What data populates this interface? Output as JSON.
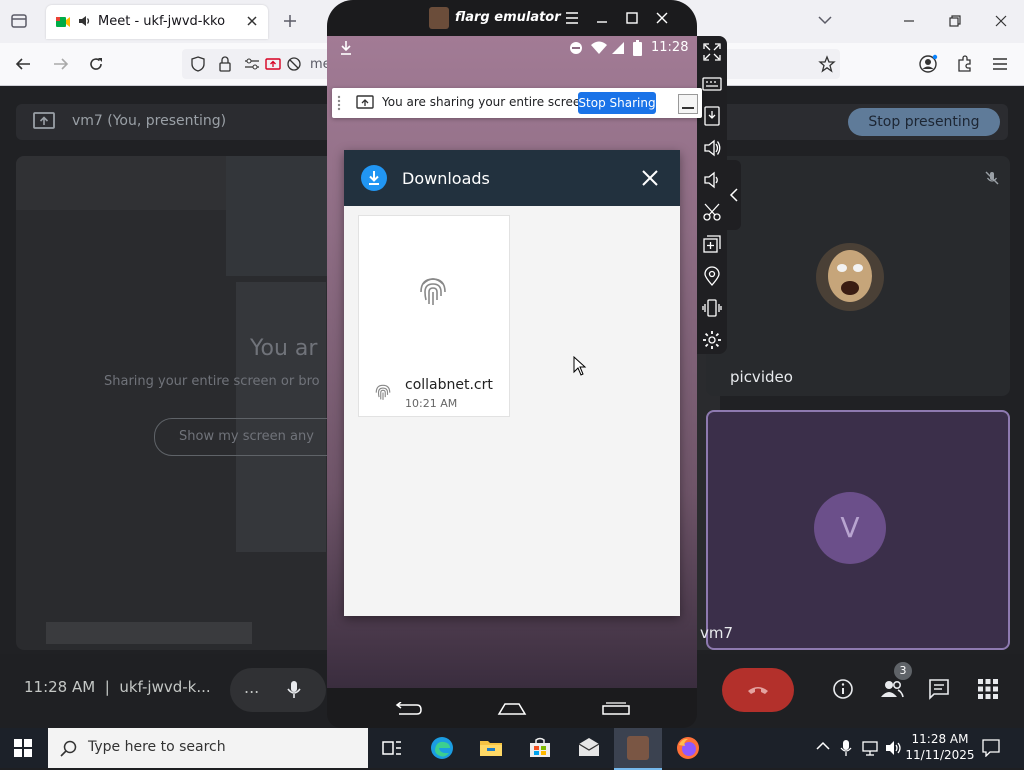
{
  "browser": {
    "tab_title": "Meet - ukf-jwvd-kko",
    "url_fragment": "me"
  },
  "meet": {
    "presenting_label": "vm7 (You, presenting)",
    "stop_presenting": "Stop presenting",
    "shared_text_big": "You ar",
    "shared_text_sub": "Sharing your entire screen or bro",
    "show_screen_btn": "Show my screen any",
    "participant_picvideo": "picvideo",
    "participant_vm7": "vm7",
    "avatar_letter": "V",
    "clock": "11:28 AM",
    "meeting_code": "ukf-jwvd-k...",
    "people_count": "3",
    "more_dots": "..."
  },
  "emulator": {
    "title": "flarg emulator",
    "status_time": "11:28",
    "share_notice": "You are sharing your entire screen.",
    "stop_sharing": "Stop Sharing",
    "downloads_title": "Downloads",
    "file": {
      "name": "collabnet.crt",
      "time": "10:21 AM"
    }
  },
  "taskbar": {
    "search_placeholder": "Type here to search",
    "time": "11:28 AM",
    "date": "11/11/2025"
  },
  "colors": {
    "accent_blue": "#1a73e8",
    "end_call_red": "#b3302b",
    "downloads_header": "#22313e"
  }
}
